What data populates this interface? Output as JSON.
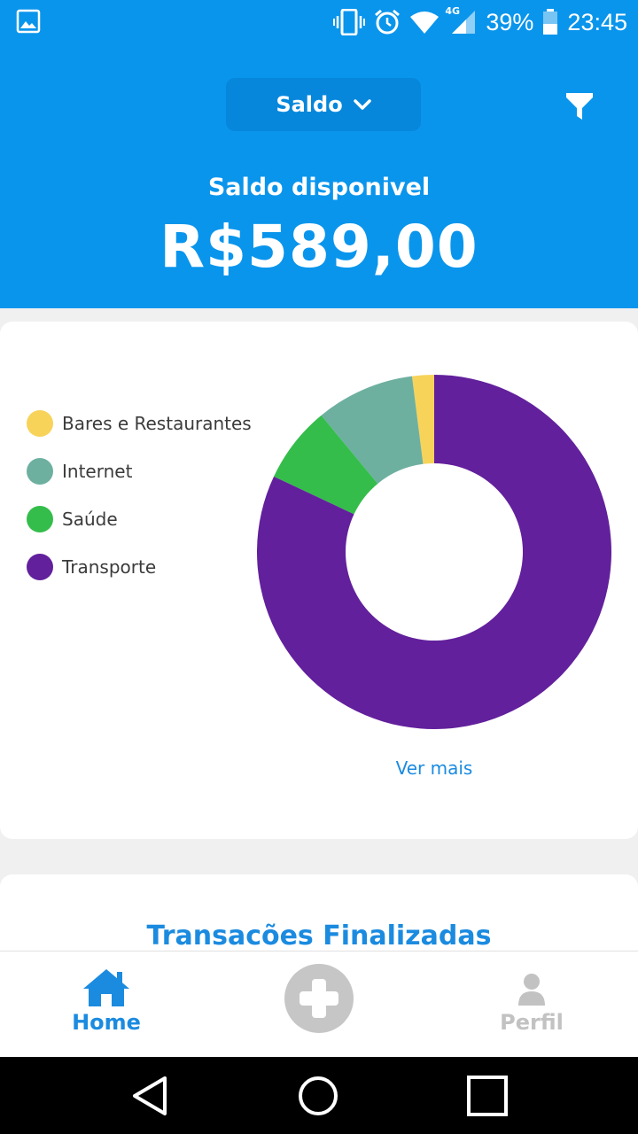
{
  "status_bar": {
    "battery": "39%",
    "time": "23:45",
    "network": "4G"
  },
  "header": {
    "dropdown_label": "Saldo",
    "balance_label": "Saldo disponivel",
    "balance_value": "R$589,00"
  },
  "chart_data": {
    "type": "pie",
    "categories": [
      "Bares e Restaurantes",
      "Internet",
      "Saúde",
      "Transporte"
    ],
    "values": [
      2,
      9,
      7,
      82
    ],
    "colors": [
      "#f7d35a",
      "#6db0a0",
      "#34bd4b",
      "#62209c"
    ],
    "legend_placement": "left",
    "donut": true
  },
  "card": {
    "ver_mais": "Ver mais"
  },
  "transactions": {
    "title": "Transacões Finalizadas"
  },
  "bottom_nav": {
    "home_label": "Home",
    "perfil_label": "Perfil"
  }
}
